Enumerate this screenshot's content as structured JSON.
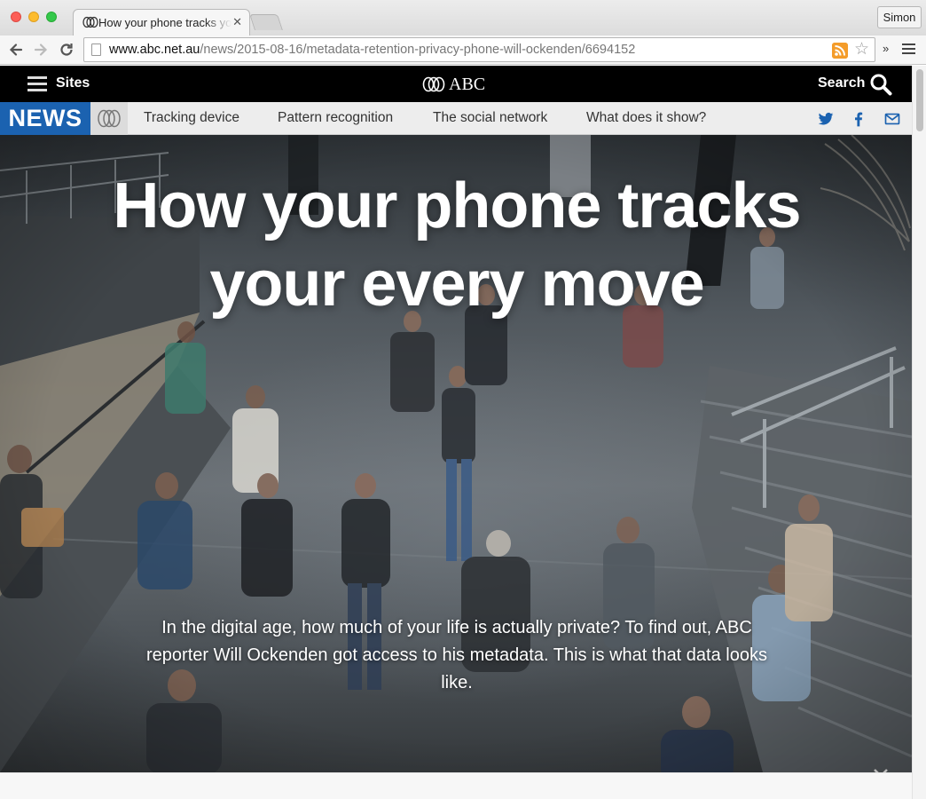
{
  "browser": {
    "tab": {
      "title": "How your phone tracks your every move - ABC News",
      "close_glyph": "✕"
    },
    "profile_label": "Simon",
    "url": {
      "host": "www.abc.net.au",
      "path": "/news/2015-08-16/metadata-retention-privacy-phone-will-ockenden/6694152"
    },
    "extensions_overflow": "»",
    "icons": {
      "back": "arrow-left-icon",
      "forward": "arrow-right-icon",
      "reload": "reload-icon",
      "rss": "rss-icon",
      "star": "star-icon",
      "menu": "hamburger-menu-icon"
    }
  },
  "abc_header": {
    "sites_label": "Sites",
    "logo_text": "ABC",
    "search_label": "Search"
  },
  "subnav": {
    "badge": "NEWS",
    "links": [
      "Tracking device",
      "Pattern recognition",
      "The social network",
      "What does it show?"
    ],
    "social": [
      "twitter-icon",
      "facebook-icon",
      "email-icon"
    ]
  },
  "hero": {
    "title_line1": "How your phone tracks",
    "title_line2": "your every move",
    "lede": "In the digital age, how much of your life is actually private? To find out, ABC reporter Will Ockenden got access to his metadata. This is what that data looks like."
  },
  "colors": {
    "header_bg": "#000000",
    "news_blue": "#1b62b0",
    "subnav_bg": "#ededed",
    "link_blue": "#1b62b0"
  }
}
